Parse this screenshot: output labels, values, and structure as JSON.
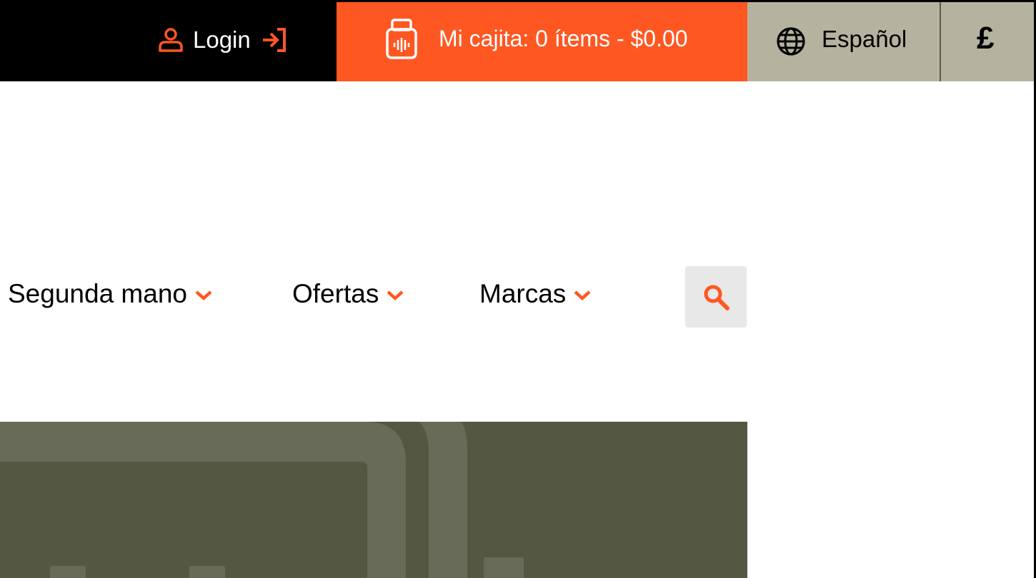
{
  "topbar": {
    "login_label": "Login",
    "cart_label": "Mi cajita: 0 ítems - $0.00",
    "language_label": "Español",
    "currency_symbol": "£"
  },
  "nav": {
    "items": [
      {
        "label": "Segunda mano"
      },
      {
        "label": "Ofertas"
      },
      {
        "label": "Marcas"
      }
    ]
  },
  "icons": {
    "login": "user-icon",
    "login_arrow": "enter-icon",
    "cart": "box-icon",
    "language": "globe-icon",
    "dropdown": "chevron-down-icon",
    "search": "search-icon"
  },
  "colors": {
    "accent": "#ff5722",
    "topbar_dark": "#000000",
    "topbar_neutral": "#b5b29f",
    "hero_bg": "#545843",
    "hero_line": "#676b58",
    "search_bg": "#e8e8e8"
  }
}
